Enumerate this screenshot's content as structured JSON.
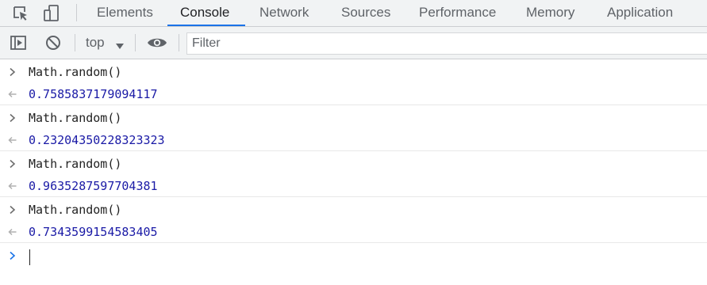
{
  "tabs": [
    {
      "label": "Elements",
      "active": false
    },
    {
      "label": "Console",
      "active": true
    },
    {
      "label": "Network",
      "active": false
    },
    {
      "label": "Sources",
      "active": false
    },
    {
      "label": "Performance",
      "active": false
    },
    {
      "label": "Memory",
      "active": false
    },
    {
      "label": "Application",
      "active": false
    }
  ],
  "toolbar": {
    "context": "top",
    "filter_placeholder": "Filter"
  },
  "console": {
    "entries": [
      {
        "input": "Math.random()",
        "result": "0.7585837179094117"
      },
      {
        "input": "Math.random()",
        "result": "0.23204350228323323"
      },
      {
        "input": "Math.random()",
        "result": "0.9635287597704381"
      },
      {
        "input": "Math.random()",
        "result": "0.7343599154583405"
      }
    ],
    "prompt_value": ""
  },
  "colors": {
    "accent": "#1a73e8",
    "result_text": "#1a1aa6",
    "toolbar_bg": "#f1f3f4"
  }
}
